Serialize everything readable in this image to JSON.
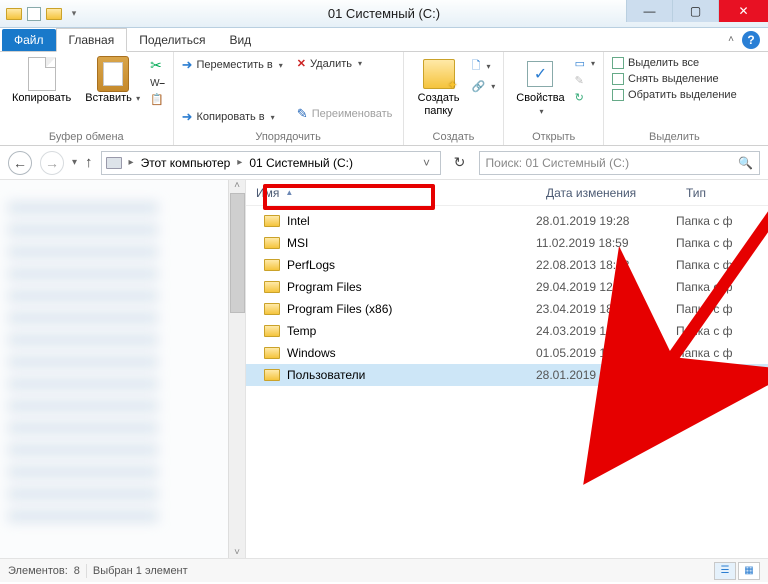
{
  "window": {
    "title": "01 Системный (C:)"
  },
  "tabs": {
    "file": "Файл",
    "home": "Главная",
    "share": "Поделиться",
    "view": "Вид"
  },
  "ribbon": {
    "clipboard": {
      "copy": "Копировать",
      "paste": "Вставить",
      "group": "Буфер обмена"
    },
    "organize": {
      "move_to": "Переместить в",
      "copy_to": "Копировать в",
      "delete": "Удалить",
      "rename": "Переименовать",
      "group": "Упорядочить"
    },
    "new": {
      "new_folder": "Создать\nпапку",
      "group": "Создать"
    },
    "open": {
      "properties": "Свойства",
      "group": "Открыть"
    },
    "select": {
      "select_all": "Выделить все",
      "select_none": "Снять выделение",
      "invert": "Обратить выделение",
      "group": "Выделить"
    }
  },
  "nav": {
    "this_pc": "Этот компьютер",
    "location": "01 Системный (C:)",
    "search_placeholder": "Поиск: 01 Системный (C:)"
  },
  "columns": {
    "name": "Имя",
    "date": "Дата изменения",
    "type": "Тип"
  },
  "rows": [
    {
      "name": "Intel",
      "date": "28.01.2019 19:28",
      "type": "Папка с ф"
    },
    {
      "name": "MSI",
      "date": "11.02.2019 18:59",
      "type": "Папка с ф"
    },
    {
      "name": "PerfLogs",
      "date": "22.08.2013 18:22",
      "type": "Папка с ф"
    },
    {
      "name": "Program Files",
      "date": "29.04.2019 12:57",
      "type": "Папка с ф"
    },
    {
      "name": "Program Files (x86)",
      "date": "23.04.2019 18:22",
      "type": "Папка с ф"
    },
    {
      "name": "Temp",
      "date": "24.03.2019 15:53",
      "type": "Папка с ф"
    },
    {
      "name": "Windows",
      "date": "01.05.2019 14:05",
      "type": "Папка с ф"
    },
    {
      "name": "Пользователи",
      "date": "28.01.2019 18:27",
      "type": "Папка с ф"
    }
  ],
  "selected_index": 7,
  "status": {
    "elements_label": "Элементов:",
    "elements_count": "8",
    "selection_label": "Выбран 1 элемент"
  }
}
